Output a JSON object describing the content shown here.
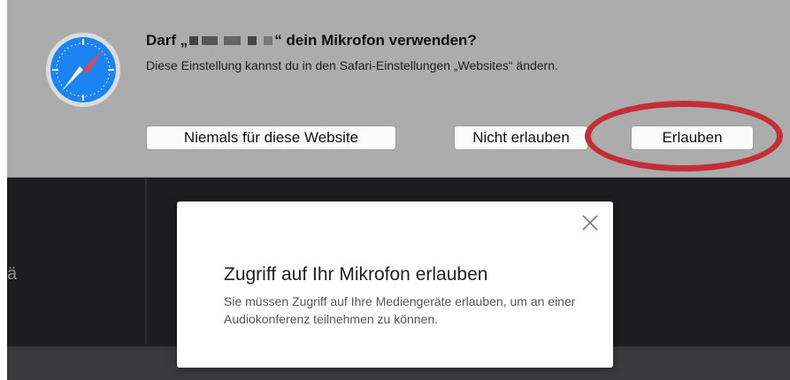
{
  "permission_sheet": {
    "title_prefix": "Darf „",
    "title_suffix": "“ dein Mikrofon verwenden?",
    "subtitle": "Diese Einstellung kannst du in den Safari-Einstellungen „Websites“ ändern.",
    "buttons": {
      "never": "Niemals für diese Website",
      "deny": "Nicht erlauben",
      "allow": "Erlauben"
    }
  },
  "modal": {
    "title": "Zugriff auf Ihr Mikrofon erlauben",
    "body": "Sie müssen Zugriff auf Ihre Mediengeräte erlauben, um an einer Audiokonferenz teilnehmen zu können."
  },
  "icons": {
    "browser": "safari-compass-icon",
    "close": "close-icon"
  },
  "colors": {
    "highlight": "#c32f36",
    "sheet_bg": "#acacac",
    "app_bg": "#1d1d1f"
  },
  "app": {
    "side_glyph": "ä"
  }
}
